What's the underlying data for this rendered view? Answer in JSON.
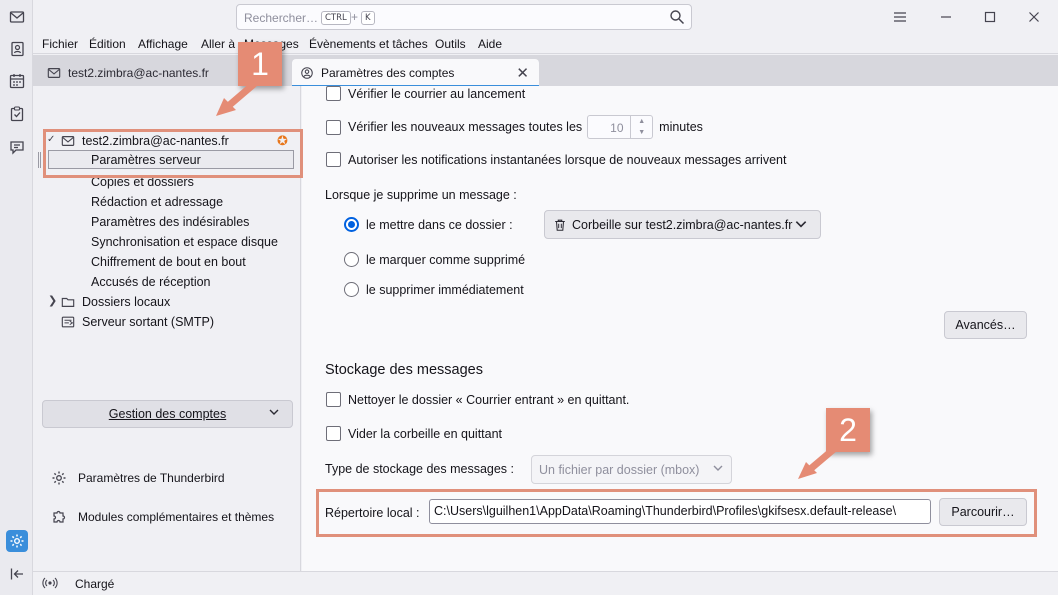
{
  "search": {
    "placeholder": "Rechercher…",
    "kbd_ctrl": "CTRL",
    "plus": "+",
    "kbd_k": "K"
  },
  "menubar": {
    "items": [
      {
        "label": "Fichier"
      },
      {
        "label": "Édition"
      },
      {
        "label": "Affichage"
      },
      {
        "label": "Aller à"
      },
      {
        "label": "Messages"
      },
      {
        "label": "Évènements et tâches"
      },
      {
        "label": "Outils"
      },
      {
        "label": "Aide"
      }
    ]
  },
  "tabs": {
    "inactive_label": "test2.zimbra@ac-nantes.fr",
    "active_label": "Paramètres des comptes",
    "close_glyph": "✕"
  },
  "sidebar": {
    "account": "test2.zimbra@ac-nantes.fr",
    "items": [
      {
        "label": "Paramètres serveur"
      },
      {
        "label": "Copies et dossiers"
      },
      {
        "label": "Rédaction et adressage"
      },
      {
        "label": "Paramètres des indésirables"
      },
      {
        "label": "Synchronisation et espace disque"
      },
      {
        "label": "Chiffrement de bout en bout"
      },
      {
        "label": "Accusés de réception"
      }
    ],
    "local_folders": "Dossiers locaux",
    "smtp": "Serveur sortant (SMTP)",
    "manage_button": "Gestion des comptes",
    "tb_settings": "Paramètres de Thunderbird",
    "addons": "Modules complémentaires et thèmes"
  },
  "content": {
    "check_startup": "Vérifier le courrier au lancement",
    "check_every_prefix": "Vérifier les nouveaux messages toutes les",
    "check_every_value": "10",
    "check_every_suffix": "minutes",
    "push_notifications": "Autoriser les notifications instantanées lorsque de nouveaux messages arrivent",
    "delete_heading": "Lorsque je supprime un message :",
    "move_to_folder": "le mettre dans ce dossier :",
    "trash_folder": "Corbeille sur test2.zimbra@ac-nantes.fr",
    "mark_deleted": "le marquer comme supprimé",
    "delete_immediately": "le supprimer immédiatement",
    "advanced_button": "Avancés…",
    "storage_heading": "Stockage des messages",
    "cleanup_inbox": "Nettoyer le dossier « Courrier entrant » en quittant.",
    "empty_trash": "Vider la corbeille en quittant",
    "storage_type_label": "Type de stockage des messages :",
    "storage_type_value": "Un fichier par dossier (mbox)",
    "local_dir_label": "Répertoire local :",
    "local_dir_value": "C:\\Users\\lguilhen1\\AppData\\Roaming\\Thunderbird\\Profiles\\gkifsesx.default-release\\",
    "browse_button": "Parcourir…"
  },
  "status": {
    "text": "Chargé"
  },
  "annotations": {
    "callout1": "1",
    "callout2": "2",
    "color": "#e58b74"
  },
  "colors": {
    "accent": "#0061e0",
    "annotation": "#e58b74"
  }
}
